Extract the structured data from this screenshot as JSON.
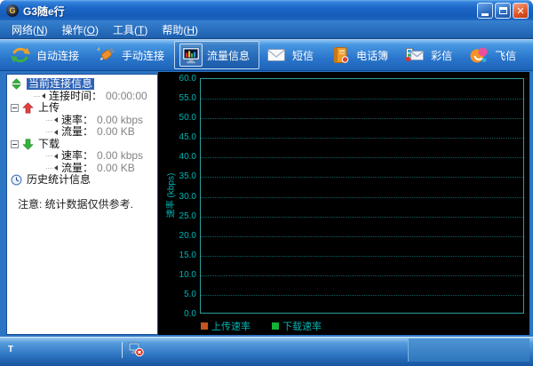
{
  "window": {
    "title": "G3随e行",
    "close_glyph": "✕"
  },
  "menu": {
    "items": [
      {
        "text": "网络",
        "key": "N"
      },
      {
        "text": "操作",
        "key": "O"
      },
      {
        "text": "工具",
        "key": "T"
      },
      {
        "text": "帮助",
        "key": "H"
      }
    ]
  },
  "toolbar": {
    "buttons": [
      {
        "icon": "auto-connect-icon",
        "label": "自动连接",
        "active": false
      },
      {
        "icon": "manual-connect-icon",
        "label": "手动连接",
        "active": false
      },
      {
        "icon": "traffic-info-icon",
        "label": "流量信息",
        "active": true
      },
      {
        "icon": "sms-icon",
        "label": "短信",
        "active": false
      },
      {
        "icon": "phonebook-icon",
        "label": "电话簿",
        "active": false
      },
      {
        "icon": "mms-icon",
        "label": "彩信",
        "active": false
      },
      {
        "icon": "fetion-icon",
        "label": "飞信",
        "active": false
      }
    ]
  },
  "sidebar": {
    "tree": [
      {
        "indent": 0,
        "icon": "updown-arrows-icon",
        "label": "当前连接信息",
        "selected": true
      },
      {
        "indent": 1,
        "bullet": true,
        "label": "连接时间：",
        "value": "00:00:00"
      },
      {
        "indent": 0,
        "expander": true,
        "icon": "upload-arrow-icon",
        "label": "上传"
      },
      {
        "indent": 2,
        "bullet": true,
        "label": "速率：",
        "value": "0.00 kbps"
      },
      {
        "indent": 2,
        "bullet": true,
        "label": "流量：",
        "value": "0.00 KB"
      },
      {
        "indent": 0,
        "expander": true,
        "icon": "download-arrow-icon",
        "label": "下载"
      },
      {
        "indent": 2,
        "bullet": true,
        "label": "速率：",
        "value": "0.00 kbps"
      },
      {
        "indent": 2,
        "bullet": true,
        "label": "流量：",
        "value": "0.00 KB"
      },
      {
        "indent": 0,
        "icon": "clock-icon",
        "label": "历史统计信息"
      }
    ],
    "note": "注意: 统计数据仅供参考."
  },
  "chart_data": {
    "type": "line",
    "title": "",
    "xlabel": "",
    "ylabel": "速率 (kbps)",
    "ylim": [
      0,
      60
    ],
    "yticks": [
      0,
      5,
      10,
      15,
      20,
      25,
      30,
      35,
      40,
      45,
      50,
      55,
      60
    ],
    "ytick_decimals": 1,
    "grid": "horizontal-dotted",
    "background_color": "#000000",
    "axis_color": "#00b4b4",
    "legend_position": "bottom-left",
    "series": [
      {
        "name": "上传速率",
        "color": "#c4551f",
        "values": []
      },
      {
        "name": "下载速率",
        "color": "#12b433",
        "values": []
      }
    ]
  },
  "statusbar": {
    "signal_text": "T",
    "network_icon": "network-disconnected-icon"
  }
}
